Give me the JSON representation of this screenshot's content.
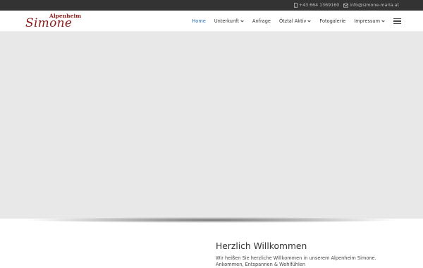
{
  "topbar": {
    "phone": "+43 664 1369160",
    "email": "info@simone-maria.at",
    "phone_icon": "mobile-phone-icon",
    "email_icon": "envelope-icon"
  },
  "logo": {
    "top": "Alpenheim",
    "main": "Simone",
    "color": "#8b1a1a"
  },
  "nav": {
    "items": [
      {
        "label": "Home",
        "active": true,
        "dropdown": false
      },
      {
        "label": "Unterkunft",
        "active": false,
        "dropdown": true
      },
      {
        "label": "Anfrage",
        "active": false,
        "dropdown": false
      },
      {
        "label": "Ötztal Aktiv",
        "active": false,
        "dropdown": true
      },
      {
        "label": "Fotogalerie",
        "active": false,
        "dropdown": false
      },
      {
        "label": "Impressum",
        "active": false,
        "dropdown": true
      }
    ],
    "active_color": "#2a6db5",
    "menu_icon": "hamburger-menu-icon"
  },
  "hero": {
    "color": "#e8e8e8"
  },
  "content": {
    "heading": "Herzlich Willkommen",
    "line1": "Wir heißen Sie herzliche Willkommen in unserem Alpenheim Simone.",
    "line2": "Ankommen, Entspannen & Wohlfühlen"
  }
}
